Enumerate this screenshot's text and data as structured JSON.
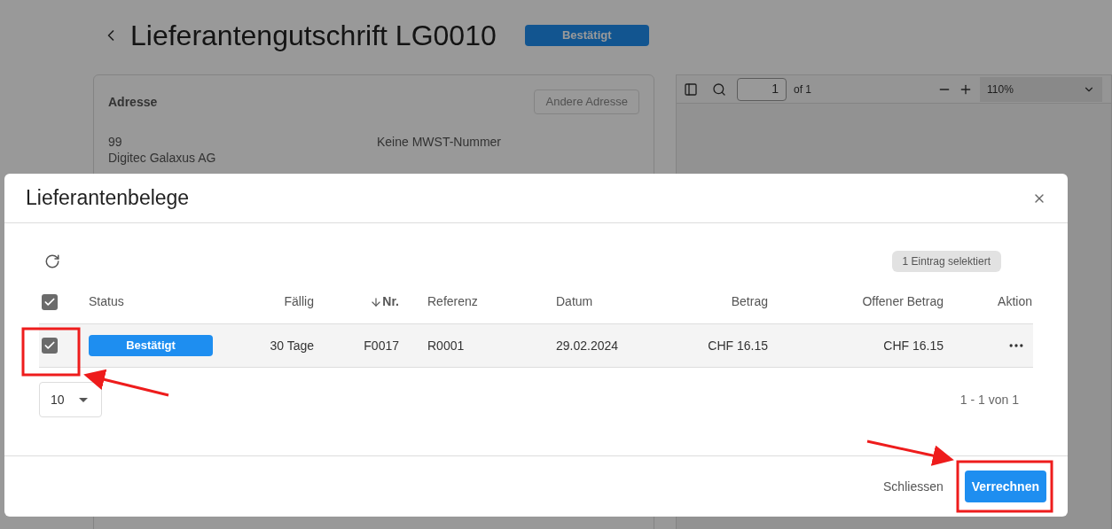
{
  "page": {
    "title": "Lieferantengutschrift LG0010",
    "status": "Bestätigt"
  },
  "address_card": {
    "title": "Adresse",
    "button": "Andere Adresse",
    "lines": [
      "99",
      "Digitec Galaxus AG"
    ],
    "vat": "Keine MWST-Nummer"
  },
  "pdf_toolbar": {
    "page": "1",
    "page_count": "of 1",
    "zoom": "110%"
  },
  "dialog": {
    "title": "Lieferantenbelege",
    "selection_badge": "1 Eintrag selektiert",
    "select_all_checked": true,
    "columns": [
      {
        "label": "Status",
        "sorted": false
      },
      {
        "label": "Fällig",
        "sorted": false
      },
      {
        "label": "Nr.",
        "sorted": true
      },
      {
        "label": "Referenz",
        "sorted": false
      },
      {
        "label": "Datum",
        "sorted": false
      },
      {
        "label": "Betrag",
        "sorted": false
      },
      {
        "label": "Offener Betrag",
        "sorted": false
      },
      {
        "label": "Aktion",
        "sorted": false
      }
    ],
    "rows": [
      {
        "checked": true,
        "cells": [
          "Bestätigt",
          "30 Tage",
          "F0017",
          "R0001",
          "29.02.2024",
          "CHF 16.15",
          "CHF 16.15"
        ]
      }
    ],
    "page_size": "10",
    "pagination": "1 - 1 von 1",
    "buttons": [
      {
        "label": "Schliessen",
        "kind": "text"
      },
      {
        "label": "Verrechnen",
        "kind": "primary"
      }
    ]
  }
}
